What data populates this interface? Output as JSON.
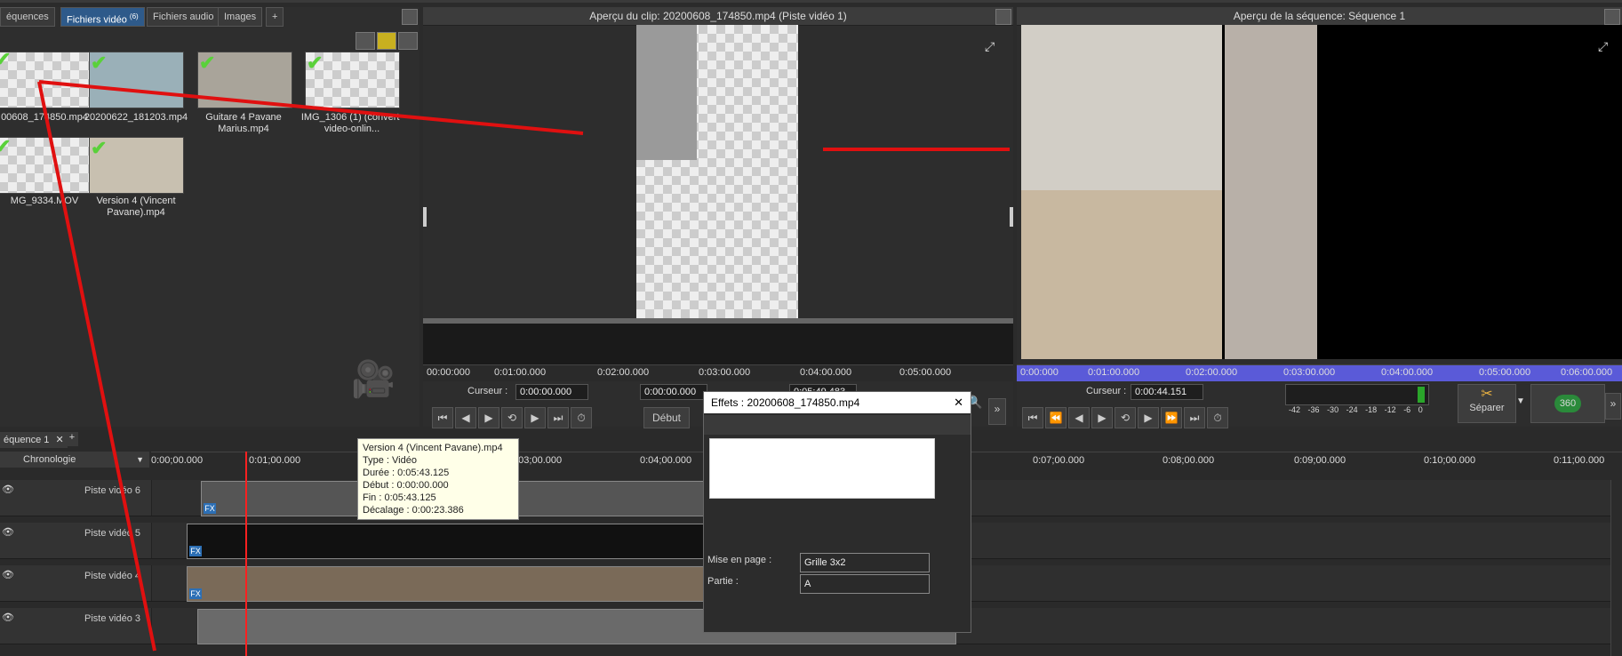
{
  "tabs": {
    "sequences": "équences",
    "video_files": "Fichiers vidéo",
    "video_files_count": "(6)",
    "audio_files": "Fichiers audio",
    "images": "Images",
    "add": "+"
  },
  "media": [
    {
      "label": "00608_174850.mp4"
    },
    {
      "label": "20200622_181203.mp4"
    },
    {
      "label": "Guitare 4 Pavane Marius.mp4"
    },
    {
      "label": "IMG_1306 (1) (convert-video-onlin..."
    },
    {
      "label": "MG_9334.MOV"
    },
    {
      "label": "Version 4 (Vincent Pavane).mp4"
    }
  ],
  "clip_preview": {
    "title": "Aperçu du clip: 20200608_174850.mp4 (Piste vidéo 1)",
    "ruler": [
      "00:00:000",
      "0:01:00.000",
      "0:02:00.000",
      "0:03:00.000",
      "0:04:00.000",
      "0:05:00.000"
    ],
    "cursor_label": "Curseur :",
    "cursor_value": "0:00:00.000",
    "field2": "0:00:00.000",
    "duration": "0:05:49.483",
    "start_label": "Début"
  },
  "seq_preview": {
    "title": "Aperçu de la séquence: Séquence 1",
    "ruler": [
      "0:00:000",
      "0:01:00.000",
      "0:02:00.000",
      "0:03:00.000",
      "0:04:00.000",
      "0:05:00.000",
      "0:06:00.000"
    ],
    "cursor_label": "Curseur :",
    "cursor_value": "0:00:44.151",
    "meter": [
      "-42",
      "-36",
      "-30",
      "-24",
      "-18",
      "-12",
      "-6",
      "0"
    ],
    "split_label": "Séparer",
    "btn360": "360"
  },
  "timeline": {
    "seq_tab": "équence 1",
    "add": "+",
    "mode": "Chronologie",
    "ruler": [
      "0:00;00.000",
      "0:01;00.000",
      "0:03;00.000",
      "0:04;00.000",
      "0:07;00.000",
      "0:08;00.000",
      "0:09;00.000",
      "0:10;00.000",
      "0:11;00.000"
    ],
    "tracks": [
      "Piste vidéo 6",
      "Piste vidéo 5",
      "Piste vidéo 4",
      "Piste vidéo 3"
    ]
  },
  "tooltip": {
    "line1": "Version 4 (Vincent Pavane).mp4",
    "line2": "Type : Vidéo",
    "line3": "Durée : 0:05:43.125",
    "line4": "Début : 0:00:00.000",
    "line5": "Fin : 0:05:43.125",
    "line6": "Décalage : 0:00:23.386"
  },
  "effects": {
    "title": "Effets : 20200608_174850.mp4",
    "close": "✕",
    "layout_label": "Mise en page :",
    "layout_value": "Grille 3x2",
    "part_label": "Partie :",
    "part_value": "A"
  },
  "colors": {
    "accent": "#2e5a8a",
    "arrow": "#e01010",
    "playhead": "#ff2020",
    "seqbar": "#5a5ad8"
  }
}
